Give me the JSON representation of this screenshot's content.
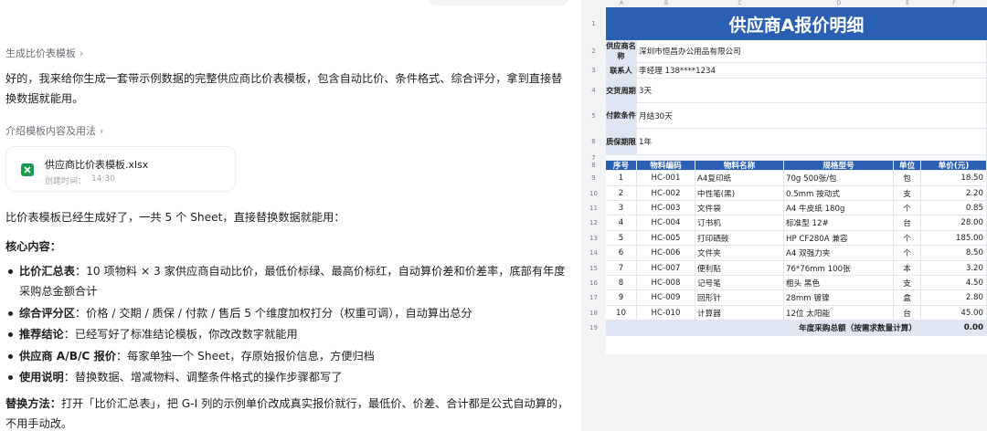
{
  "chat": {
    "step1": "生成比价表模板",
    "intro": "好的，我来给你生成一套带示例数据的完整供应商比价表模板，包含自动比价、条件格式、综合评分，拿到直接替换数据就能用。",
    "step2": "介绍模板内容及用法",
    "file": {
      "name": "供应商比价表模板.xlsx",
      "meta_label": "创建时间：",
      "meta_time": "14:30"
    },
    "summary": "比价表模板已经生成好了，一共 5 个 Sheet，直接替换数据就能用：",
    "core_heading": "核心内容：",
    "bullets": [
      {
        "key": "比价汇总表",
        "text": "：10 项物料 × 3 家供应商自动比价，最低价标绿、最高价标红，自动算价差和价差率，底部有年度采购总金额合计"
      },
      {
        "key": "综合评分区",
        "text": "：价格 / 交期 / 质保 / 付款 / 售后 5 个维度加权打分（权重可调），自动算出总分"
      },
      {
        "key": "推荐结论",
        "text": "：已经写好了标准结论模板，你改改数字就能用"
      },
      {
        "key": "供应商 A/B/C 报价",
        "text": "：每家单独一个 Sheet，存原始报价信息，方便归档"
      },
      {
        "key": "使用说明",
        "text": "：替换数据、增减物料、调整条件格式的操作步骤都写了"
      }
    ],
    "replace_key": "替换方法：",
    "replace_text": "打开「比价汇总表」，把 G-I 列的示例单价改成真实报价就行，最低价、价差、合计都是公式自动算的，不用手动改。"
  },
  "sheet": {
    "col_letters": [
      "A",
      "B",
      "C",
      "D",
      "E",
      "F"
    ],
    "title": "供应商A报价明细",
    "info": [
      {
        "label": "供应商名称",
        "value": "深圳市恒昌办公用品有限公司"
      },
      {
        "label": "联系人",
        "value": "李经理 138****1234"
      },
      {
        "label": "交货周期",
        "value": "3天"
      },
      {
        "label": "付款条件",
        "value": "月结30天"
      },
      {
        "label": "质保期限",
        "value": "1年"
      }
    ],
    "headers": [
      "序号",
      "物料编码",
      "物料名称",
      "规格型号",
      "单位",
      "单价(元)"
    ],
    "rows": [
      [
        "1",
        "HC-001",
        "A4复印纸",
        "70g 500张/包",
        "包",
        "18.50"
      ],
      [
        "2",
        "HC-002",
        "中性笔(黑)",
        "0.5mm 按动式",
        "支",
        "2.20"
      ],
      [
        "3",
        "HC-003",
        "文件袋",
        "A4 牛皮纸 180g",
        "个",
        "0.85"
      ],
      [
        "4",
        "HC-004",
        "订书机",
        "标准型 12#",
        "台",
        "28.00"
      ],
      [
        "5",
        "HC-005",
        "打印硒鼓",
        "HP CF280A 兼容",
        "个",
        "185.00"
      ],
      [
        "6",
        "HC-006",
        "文件夹",
        "A4 双强力夹",
        "个",
        "8.50"
      ],
      [
        "7",
        "HC-007",
        "便利贴",
        "76*76mm 100张",
        "本",
        "3.20"
      ],
      [
        "8",
        "HC-008",
        "记号笔",
        "粗头 黑色",
        "支",
        "4.50"
      ],
      [
        "9",
        "HC-009",
        "回形针",
        "28mm 镀镍",
        "盒",
        "2.80"
      ],
      [
        "10",
        "HC-010",
        "计算器",
        "12位 太阳能",
        "台",
        "45.00"
      ]
    ],
    "total_label": "年度采购总额（按需求数量计算）",
    "total_value": "0.00",
    "row_numbers": [
      "1",
      "2",
      "3",
      "4",
      "5",
      "6",
      "7",
      "8",
      "9",
      "10",
      "11",
      "12",
      "13",
      "14",
      "15",
      "16",
      "17",
      "18",
      "19"
    ]
  }
}
